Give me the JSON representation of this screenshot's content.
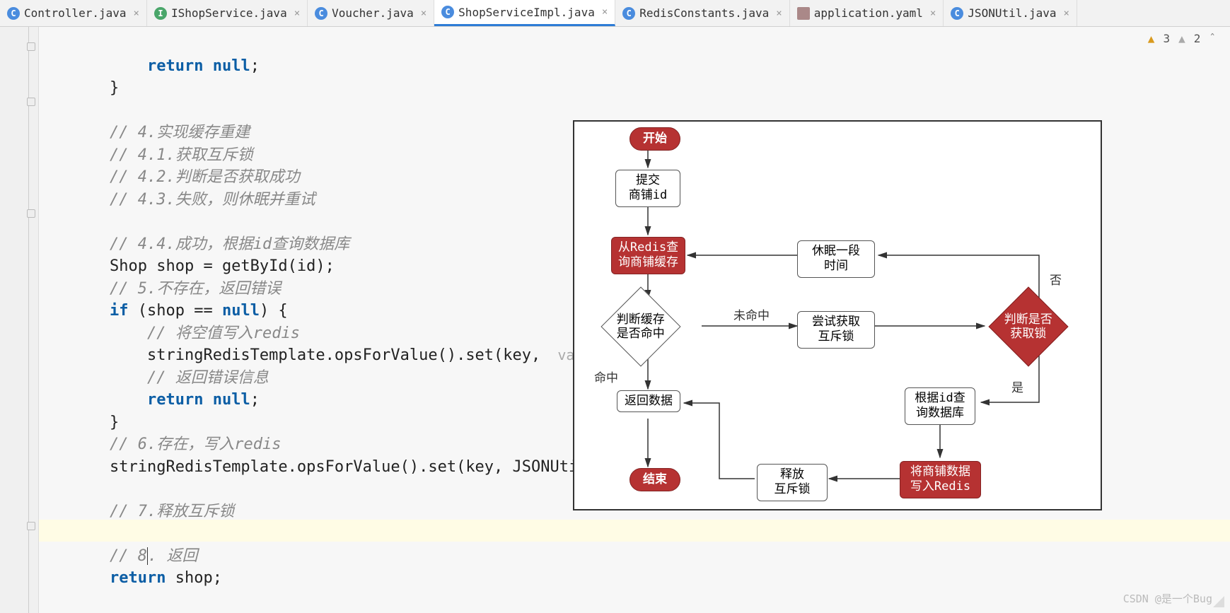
{
  "tabs": [
    {
      "icon": "C",
      "iconClass": "c",
      "label": "Controller.java"
    },
    {
      "icon": "I",
      "iconClass": "i",
      "label": "IShopService.java"
    },
    {
      "icon": "C",
      "iconClass": "c",
      "label": "Voucher.java"
    },
    {
      "icon": "C",
      "iconClass": "c",
      "label": "ShopServiceImpl.java",
      "active": true
    },
    {
      "icon": "C",
      "iconClass": "c",
      "label": "RedisConstants.java"
    },
    {
      "icon": "",
      "iconClass": "y",
      "label": "application.yaml"
    },
    {
      "icon": "C",
      "iconClass": "c",
      "label": "JSONUtil.java"
    }
  ],
  "warnings": {
    "warn": "3",
    "info": "2"
  },
  "code": {
    "l1": "    return null;",
    "l2": "}",
    "c4": "// 4.实现缓存重建",
    "c41": "// 4.1.获取互斥锁",
    "c42": "// 4.2.判断是否获取成功",
    "c43": "// 4.3.失败，则休眠并重试",
    "c44": "// 4.4.成功，根据id查询数据库",
    "l_shop": "Shop shop = getById(id);",
    "c5": "// 5.不存在，返回错误",
    "l_if": "if (shop == null) {",
    "c_red": "    // 将空值写入redis",
    "l_set": "    stringRedisTemplate.opsForValue().set(key,",
    "hint_val": "  value:",
    "c_err": "    // 返回错误信息",
    "l_ret": "    return null;",
    "l_cb": "}",
    "c6": "// 6.存在，写入redis",
    "l_set2": "stringRedisTemplate.opsForValue().set(key, JSONUtil.",
    "c7": "// 7.释放互斥锁",
    "c8": "// 8. 返回",
    "l_retshop": "return shop;"
  },
  "flowchart": {
    "start": "开始",
    "submit": "提交\n商铺id",
    "redis_query": "从Redis查\n询商铺缓存",
    "sleep": "休眠一段\n时间",
    "hit_check": "判断缓存\n是否命中",
    "miss": "未命中",
    "try_lock": "尝试获取\n互斥锁",
    "lock_check": "判断是否\n获取锁",
    "no": "否",
    "hit": "命中",
    "yes": "是",
    "return_data": "返回数据",
    "query_db": "根据id查\n询数据库",
    "end": "结束",
    "release": "释放\n互斥锁",
    "write_redis": "将商铺数据\n写入Redis"
  },
  "watermark": "CSDN @是一个Bug"
}
